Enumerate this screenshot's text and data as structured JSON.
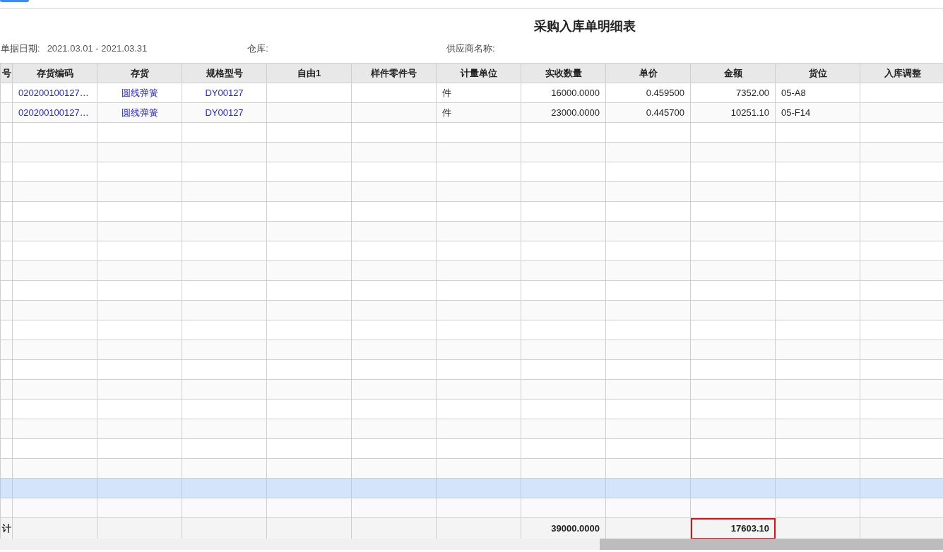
{
  "title": "采购入库单明细表",
  "filters": [
    {
      "label": "单据日期:",
      "value": "2021.03.01 - 2021.03.31"
    },
    {
      "label": "仓库:"
    },
    {
      "label": "供应商名称:"
    }
  ],
  "table": {
    "columns": [
      {
        "label": "号",
        "kind": "index"
      },
      {
        "label": "存货编码",
        "kind": "code_link"
      },
      {
        "label": "存货",
        "kind": "name_link"
      },
      {
        "label": "规格型号",
        "kind": "name_link"
      },
      {
        "label": "自由1",
        "kind": "text"
      },
      {
        "label": "样件零件号",
        "kind": "text"
      },
      {
        "label": "计量单位",
        "kind": "text"
      },
      {
        "label": "实收数量",
        "kind": "number"
      },
      {
        "label": "单价",
        "kind": "number"
      },
      {
        "label": "金额",
        "kind": "number"
      },
      {
        "label": "货位",
        "kind": "text"
      },
      {
        "label": "入库调整",
        "kind": "text"
      }
    ],
    "rows": [
      {
        "cells": [
          null,
          "020200100127…",
          "圆线弹簧",
          "DY00127",
          null,
          null,
          "件",
          "16000.0000",
          "0.459500",
          "7352.00",
          "05-A8",
          null
        ]
      },
      {
        "cells": [
          null,
          "020200100127…",
          "圆线弹簧",
          "DY00127",
          null,
          null,
          "件",
          "23000.0000",
          "0.445700",
          "10251.10",
          "05-F14",
          null
        ]
      }
    ],
    "blank_rows": [
      {
        "highlighted": false
      },
      {
        "highlighted": false
      },
      {
        "highlighted": false
      },
      {
        "highlighted": false
      },
      {
        "highlighted": false
      },
      {
        "highlighted": false
      },
      {
        "highlighted": false
      },
      {
        "highlighted": false
      },
      {
        "highlighted": false
      },
      {
        "highlighted": false
      },
      {
        "highlighted": false
      },
      {
        "highlighted": false
      },
      {
        "highlighted": false
      },
      {
        "highlighted": false
      },
      {
        "highlighted": false
      },
      {
        "highlighted": false
      },
      {
        "highlighted": false
      },
      {
        "highlighted": false
      },
      {
        "highlighted": true
      },
      {
        "highlighted": false
      }
    ],
    "total_row": {
      "label": "计",
      "quantity": "39000.0000",
      "amount": "17603.10",
      "amount_outlined": true
    }
  }
}
